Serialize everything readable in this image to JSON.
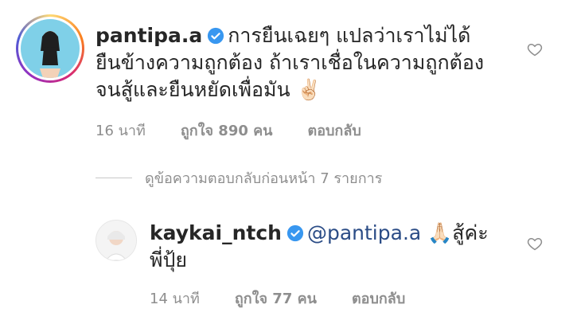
{
  "comments": [
    {
      "username": "pantipa.a",
      "text": "การยืนเฉยๆ แปลว่าเราไม่ได้ยืนข้างความถูกต้อง ถ้าเราเชื่อในความถูกต้อง จนสู้และยืนหยัดเพื่อมัน ✌🏻",
      "time": "16 นาที",
      "likes": "ถูกใจ 890 คน",
      "reply": "ตอบกลับ"
    },
    {
      "username": "kaykai_ntch",
      "mention": "@pantipa.a",
      "text": "🙏🏻สู้ค่ะพี่ปุ้ย",
      "time": "14 นาที",
      "likes": "ถูกใจ 77 คน",
      "reply": "ตอบกลับ"
    }
  ],
  "view_replies": "ดูข้อความตอบกลับก่อนหน้า 7 รายการ",
  "colors": {
    "text": "#262626",
    "muted": "#8e8e8e",
    "verified": "#3897f0",
    "mention": "#2b4c86"
  },
  "icons": {
    "verified": "verified-badge-icon",
    "like": "heart-outline-icon"
  }
}
